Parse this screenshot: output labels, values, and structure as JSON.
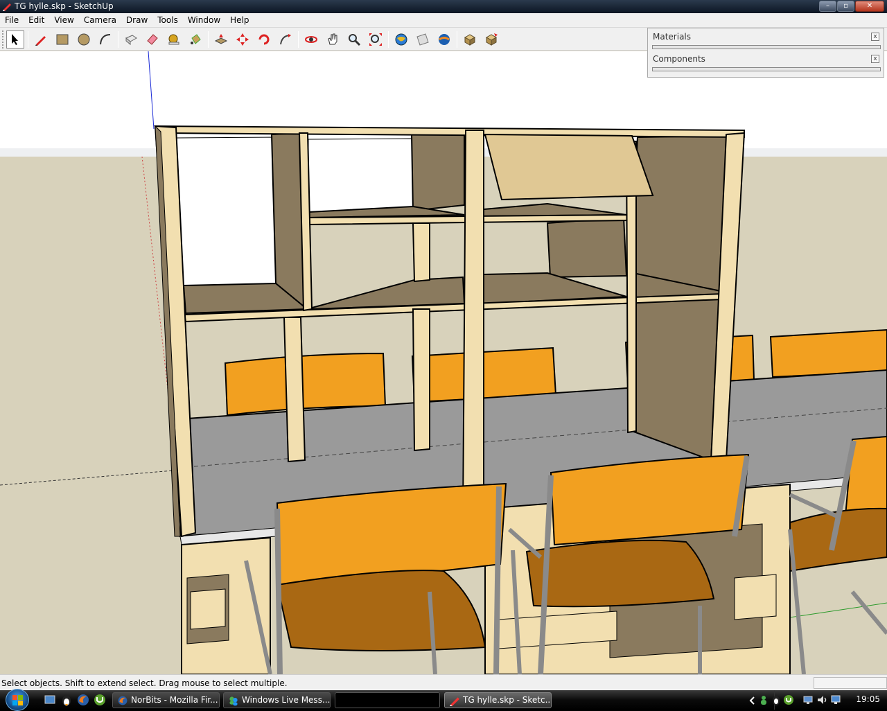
{
  "window": {
    "title": "TG hylle.skp - SketchUp",
    "controls": {
      "minimize": "–",
      "maximize": "▫",
      "close": "✕"
    }
  },
  "menu": [
    "File",
    "Edit",
    "View",
    "Camera",
    "Draw",
    "Tools",
    "Window",
    "Help"
  ],
  "toolbar": {
    "tools": [
      "select",
      "pencil",
      "rectangle",
      "circle",
      "arc",
      "make-component",
      "eraser",
      "tape-measure",
      "paint-bucket",
      "push-pull",
      "move",
      "rotate",
      "follow-me",
      "orbit",
      "pan",
      "zoom",
      "zoom-extents",
      "get-models",
      "share-model",
      "google-earth",
      "get-photo-texture",
      "share-component"
    ],
    "active_tool": "select"
  },
  "panels": {
    "materials": {
      "title": "Materials",
      "close": "x"
    },
    "components": {
      "title": "Components",
      "close": "x"
    }
  },
  "status": {
    "message": "Select objects. Shift to extend select. Drag mouse to select multiple."
  },
  "taskbar": {
    "tasks": [
      {
        "label": "NorBits - Mozilla Fir...",
        "icon": "firefox-icon",
        "active": false
      },
      {
        "label": "Windows Live Mess...",
        "icon": "messenger-icon",
        "active": false
      },
      {
        "label": "",
        "icon": "",
        "active": false
      },
      {
        "label": "TG hylle.skp - Sketc...",
        "icon": "sketchup-icon",
        "active": true
      }
    ],
    "clock": "19:05"
  },
  "colors": {
    "sky": "#ffffff",
    "ground": "#d8d2bb",
    "wood_light": "#f2dfb0",
    "wood_shadow": "#8a7a5e",
    "table_top": "#9a9a9a",
    "chair_orange": "#f2a020",
    "chair_orange_dark": "#a96813",
    "chair_frame": "#8a8a8a"
  }
}
